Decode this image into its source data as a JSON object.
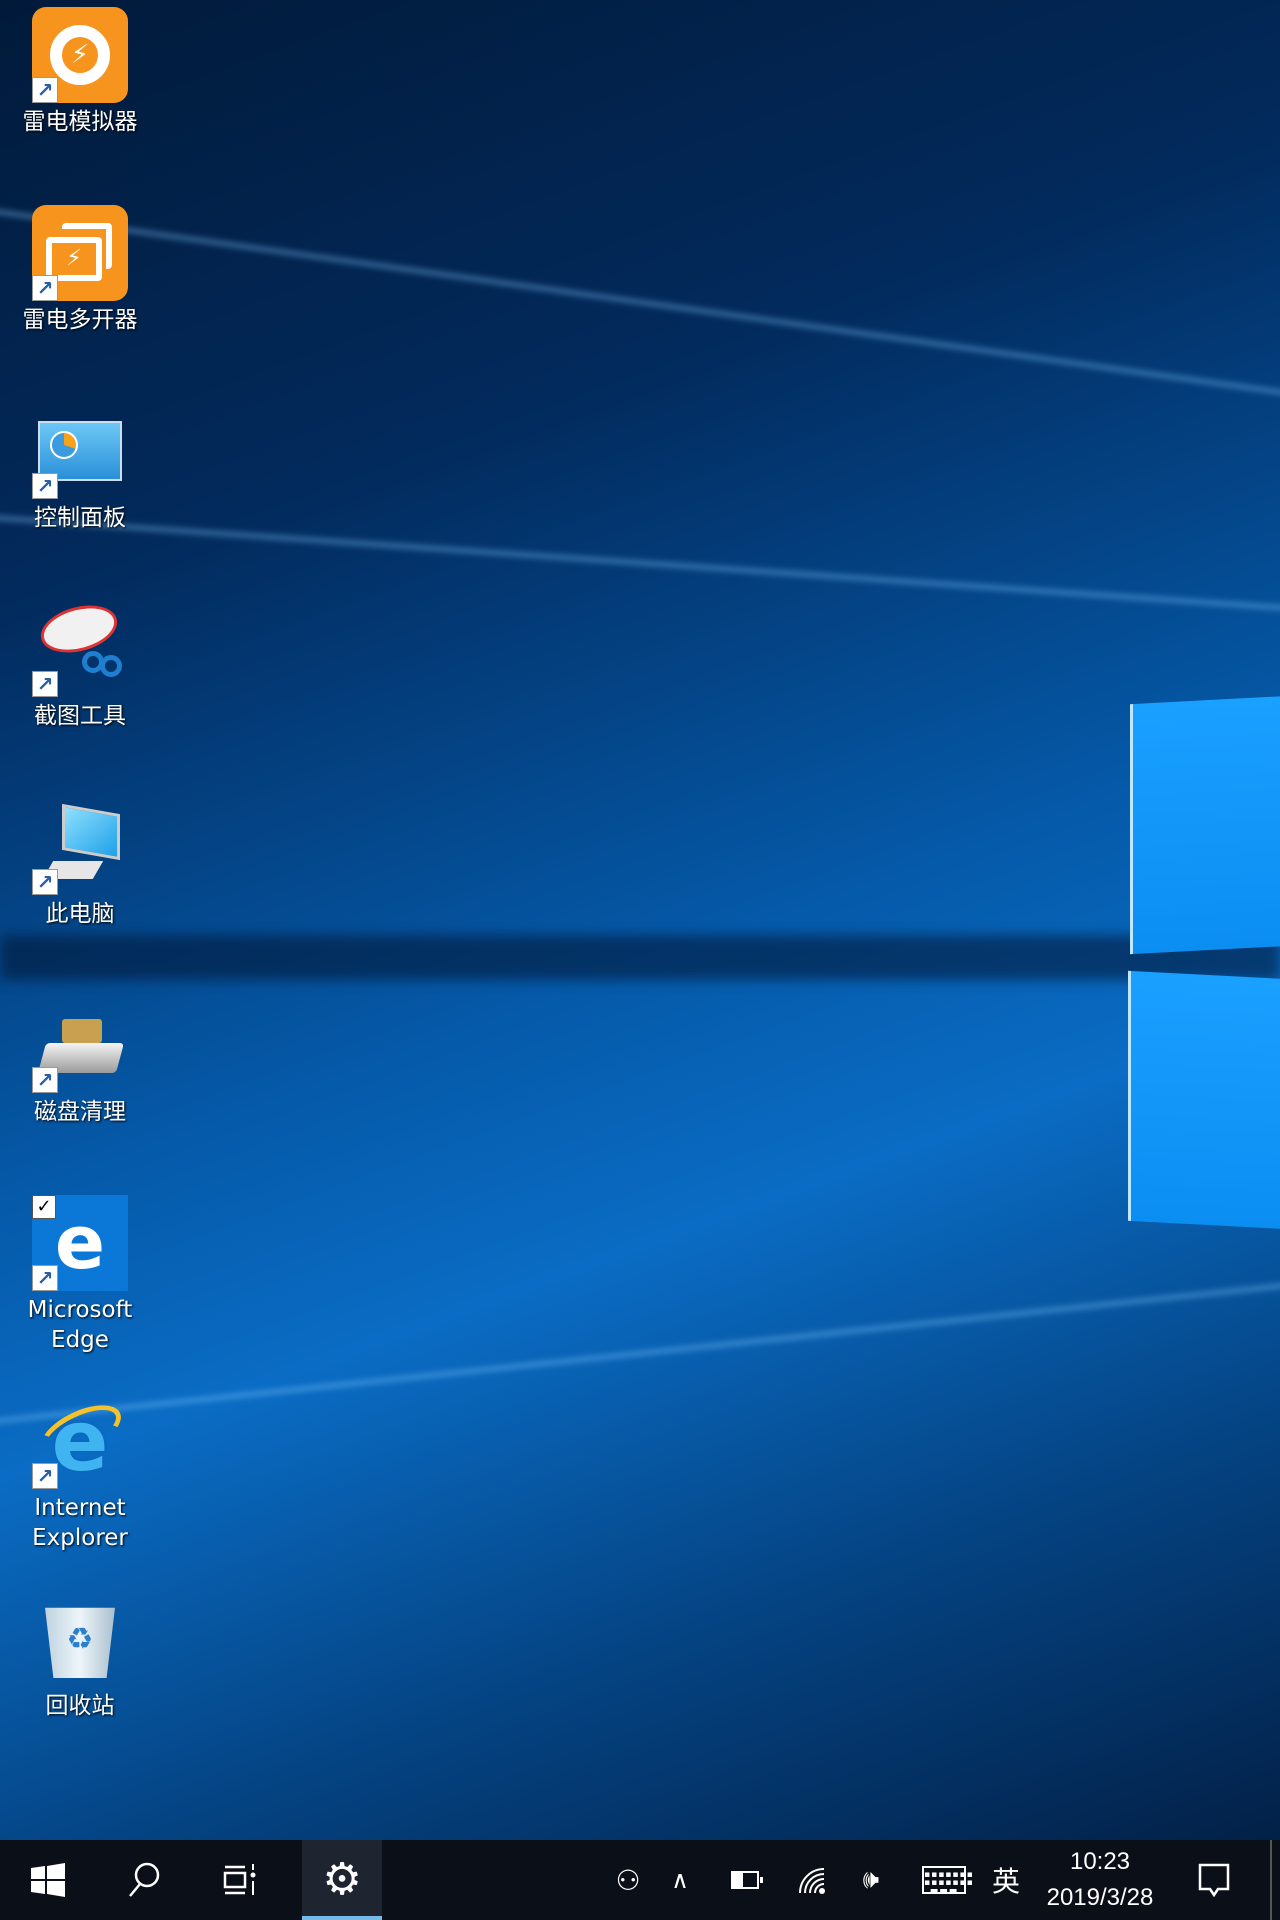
{
  "desktop_icons": [
    {
      "label": "雷电模拟器",
      "icon": "ldplayer-icon",
      "shortcut": true
    },
    {
      "label": "雷电多开器",
      "icon": "ldmultiplayer-icon",
      "shortcut": true
    },
    {
      "label": "控制面板",
      "icon": "control-panel-icon",
      "shortcut": true
    },
    {
      "label": "截图工具",
      "icon": "snipping-tool-icon",
      "shortcut": true
    },
    {
      "label": "此电脑",
      "icon": "this-pc-icon",
      "shortcut": true
    },
    {
      "label": "磁盘清理",
      "icon": "disk-cleanup-icon",
      "shortcut": true
    },
    {
      "label": "Microsoft Edge",
      "icon": "edge-icon",
      "shortcut": true,
      "checked": true
    },
    {
      "label": "Internet Explorer",
      "icon": "ie-icon",
      "shortcut": true
    },
    {
      "label": "回收站",
      "icon": "recycle-bin-icon",
      "shortcut": false
    }
  ],
  "taskbar": {
    "ime": "英",
    "time": "10:23",
    "date": "2019/3/28",
    "active_app": "settings"
  },
  "colors": {
    "taskbar": "#0b0f17",
    "active_indicator": "#76b9ed",
    "ld_orange": "#f7941d"
  }
}
